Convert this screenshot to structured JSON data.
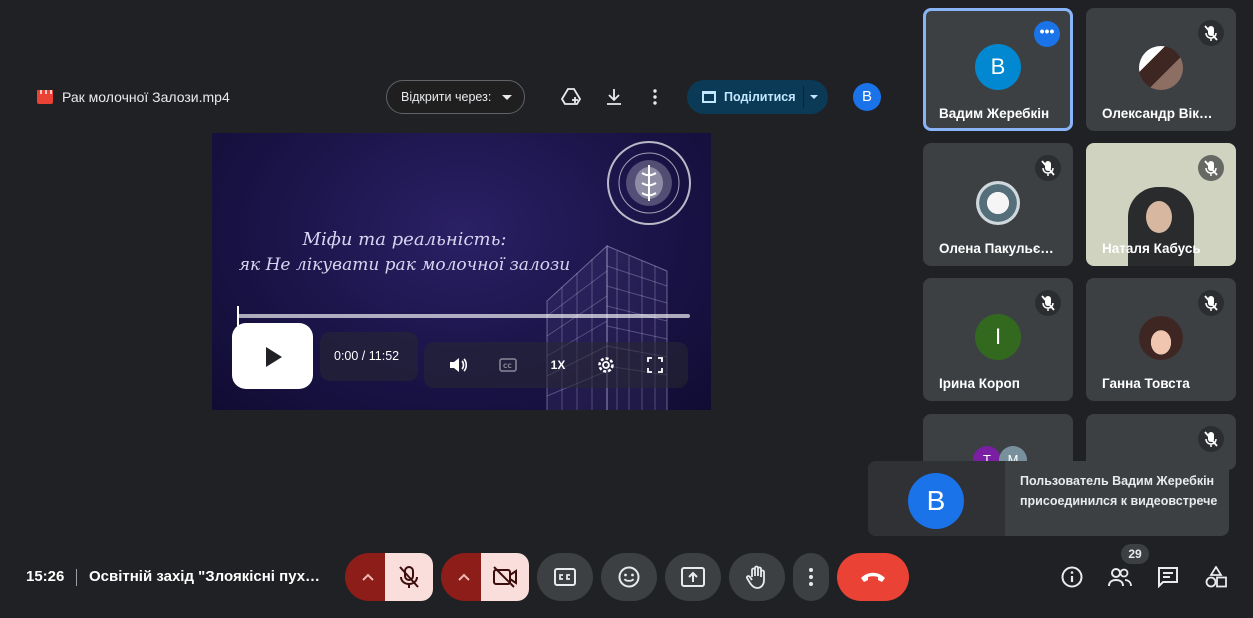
{
  "file": {
    "name": "Рак молочної Залози.mp4",
    "open_with_label": "Відкрити через:",
    "share_label": "Поділитися",
    "avatar_initial": "B"
  },
  "video": {
    "title_line1": "Міфи та реальність:",
    "title_line2": "як Не лікувати рак молочної залози",
    "seal_text": "KHARKIV INTERNATIONAL MEDICAL UNIVERSITY",
    "time": "0:00 / 11:52",
    "speed": "1X",
    "progress": 0
  },
  "participants": [
    {
      "name": "Вадим Жеребкін",
      "initial": "B",
      "color": "#0288d1",
      "active": true
    },
    {
      "name": "Олександр Вік…",
      "photo": true
    },
    {
      "name": "Олена Пакульє…",
      "photo": true
    },
    {
      "name": "Наталя Кабусь",
      "video": true
    },
    {
      "name": "Ірина Короп",
      "initial": "I",
      "color": "#33691e"
    },
    {
      "name": "Ганна Товста",
      "photo": true
    },
    {
      "group_initials": [
        "T",
        "M"
      ]
    },
    {
      "photo": true
    }
  ],
  "toast": {
    "avatar_initial": "B",
    "message": "Пользователь Вадим Жеребкін присоединился к видеовстрече"
  },
  "bottom": {
    "time": "15:26",
    "meeting_title": "Освітній захід \"Злоякісні пух…",
    "participant_count": "29"
  },
  "colors": {
    "background": "#202124",
    "tile": "#3c4043",
    "active_border": "#8ab4f8",
    "end_call": "#ea4335",
    "mic_off_bg": "#f9dedc",
    "mic_off_left": "#8c1d18",
    "share_bg": "#0b3a57"
  }
}
